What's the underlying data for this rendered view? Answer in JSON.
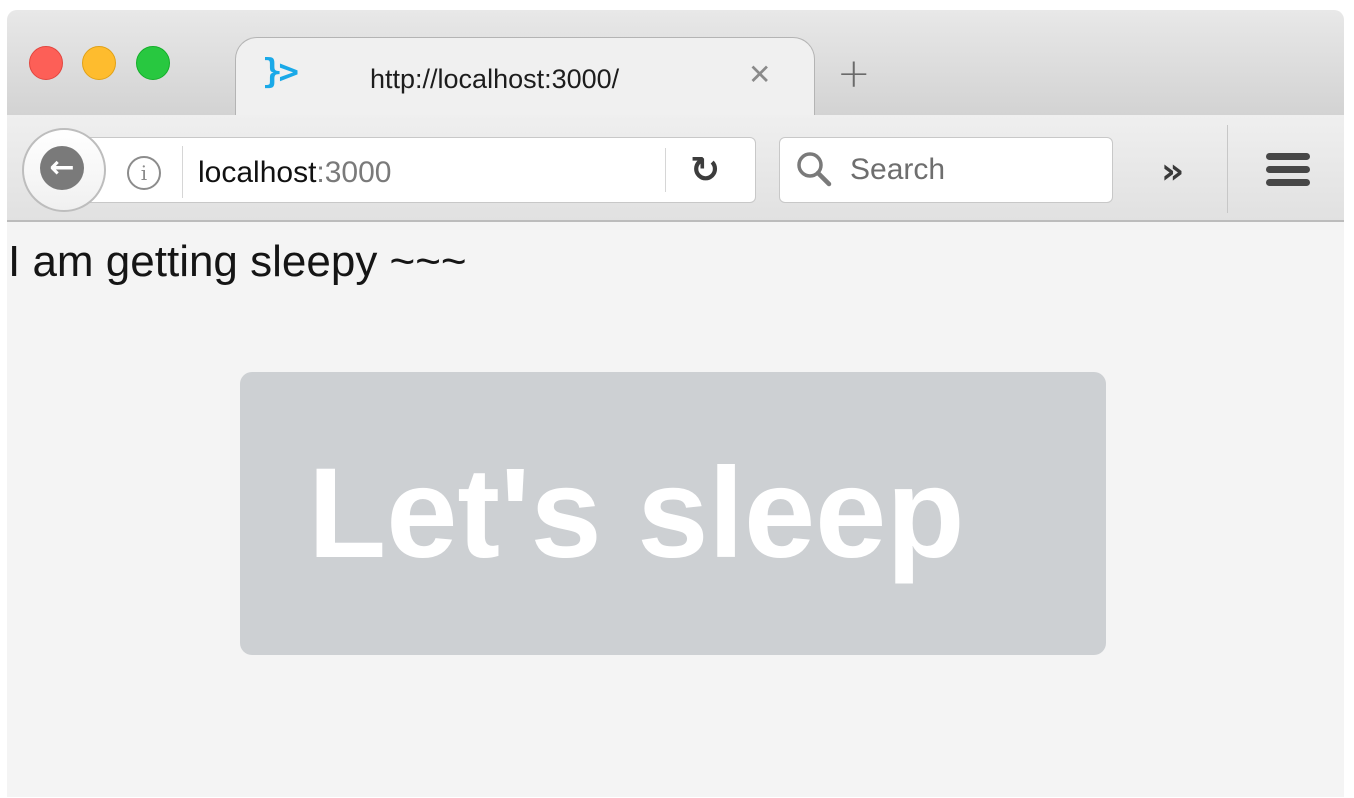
{
  "browser": {
    "tab": {
      "favicon_glyph": "}>",
      "title": "http://localhost:3000/",
      "close_glyph": "✕"
    },
    "new_tab_glyph": "+",
    "toolbar": {
      "back_glyph": "←",
      "info_glyph": "i",
      "url_host": "localhost",
      "url_port": ":3000",
      "reload_glyph": "↻",
      "search_placeholder": "Search",
      "overflow_glyph": "»"
    }
  },
  "page": {
    "headline": "I am getting sleepy ~~~",
    "button_label": "Let's sleep"
  },
  "colors": {
    "favicon": "#1aa9e8",
    "button_bg": "#cdd0d3",
    "button_text": "#ffffff",
    "traffic_close": "#fd5f57",
    "traffic_minimize": "#febc2e",
    "traffic_maximize": "#28c840"
  }
}
